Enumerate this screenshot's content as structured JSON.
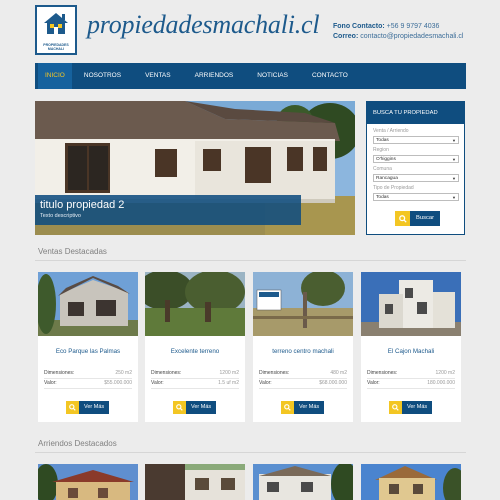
{
  "header": {
    "site_title": "propiedadesmachali.cl",
    "logo_text_1": "PROPIEDADES",
    "logo_text_2": "MACHALI",
    "phone_label": "Fono Contacto:",
    "phone_value": "+56 9 9797 4036",
    "email_label": "Correo:",
    "email_value": "contacto@propiedadesmachali.cl"
  },
  "nav": {
    "items": [
      "INICIO",
      "NOSOTROS",
      "VENTAS",
      "ARRIENDOS",
      "NOTICIAS",
      "CONTACTO"
    ],
    "active": "INICIO"
  },
  "hero": {
    "title": "titulo propiedad 2",
    "description": "Texto descriptivo"
  },
  "search": {
    "heading": "BUSCA TU PROPIEDAD",
    "fields": [
      {
        "label": "Venta / Arriendo",
        "value": "Todas"
      },
      {
        "label": "Region",
        "value": "O'higgins"
      },
      {
        "label": "Comuna",
        "value": "Rancagua"
      },
      {
        "label": "Tipo de Propiedad",
        "value": "Todas"
      }
    ],
    "button": "Buscar"
  },
  "ventas": {
    "title": "Ventas Destacadas",
    "cards": [
      {
        "name": "Eco Parque las Palmas",
        "dim_label": "Dimensiones:",
        "dim": "250 m2",
        "val_label": "Valor:",
        "val": "$55.000.000",
        "btn": "Ver Más"
      },
      {
        "name": "Excelente terreno",
        "dim_label": "Dimensiones:",
        "dim": "1200 m2",
        "val_label": "Valor:",
        "val": "1.5 uf m2",
        "btn": "Ver Más"
      },
      {
        "name": "terreno centro machali",
        "dim_label": "Dimensiones:",
        "dim": "480 m2",
        "val_label": "Valor:",
        "val": "$68.000.000",
        "btn": "Ver Más"
      },
      {
        "name": "El Cajon Machali",
        "dim_label": "Dimensiones:",
        "dim": "1200 m2",
        "val_label": "Valor:",
        "val": "180.000.000",
        "btn": "Ver Más"
      }
    ]
  },
  "arriendos": {
    "title": "Arriendos Destacados"
  },
  "icons": {
    "search": "search-icon",
    "house": "house-icon",
    "dropdown": "chevron-down-icon"
  },
  "colors": {
    "brand_blue": "#0f4d7f",
    "accent_yellow": "#f3c623"
  }
}
